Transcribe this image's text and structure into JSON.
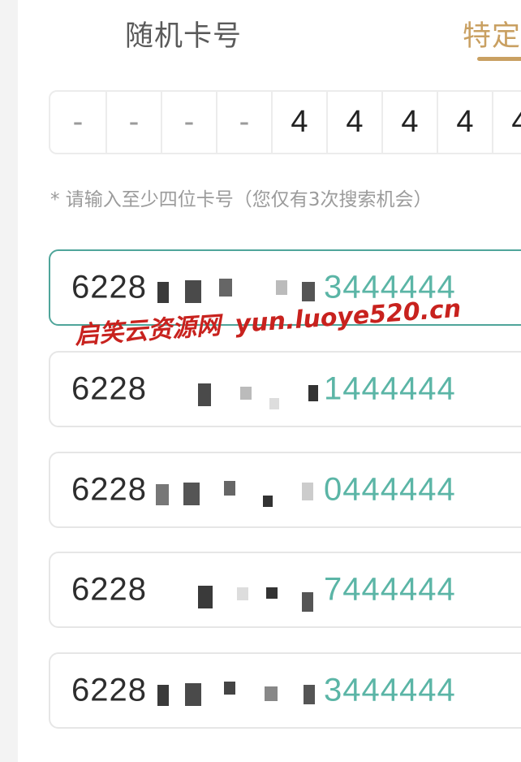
{
  "tabs": {
    "random": "随机卡号",
    "specific": "特定"
  },
  "digits": [
    "-",
    "-",
    "-",
    "-",
    "4",
    "4",
    "4",
    "4",
    "4"
  ],
  "hint": "* 请输入至少四位卡号（您仅有3次搜索机会）",
  "results": [
    {
      "prefix": "6228",
      "suffix": "3444444"
    },
    {
      "prefix": "6228",
      "suffix": "1444444"
    },
    {
      "prefix": "6228",
      "suffix": "0444444"
    },
    {
      "prefix": "6228",
      "suffix": "7444444"
    },
    {
      "prefix": "6228",
      "suffix": "3444444"
    }
  ],
  "watermark": {
    "brand": "启笑云资源网",
    "url": "yun.luoye520.cn"
  },
  "colors": {
    "accent_gold": "#c9a062",
    "accent_teal": "#5bb5a6",
    "watermark_red": "#c8221e"
  }
}
